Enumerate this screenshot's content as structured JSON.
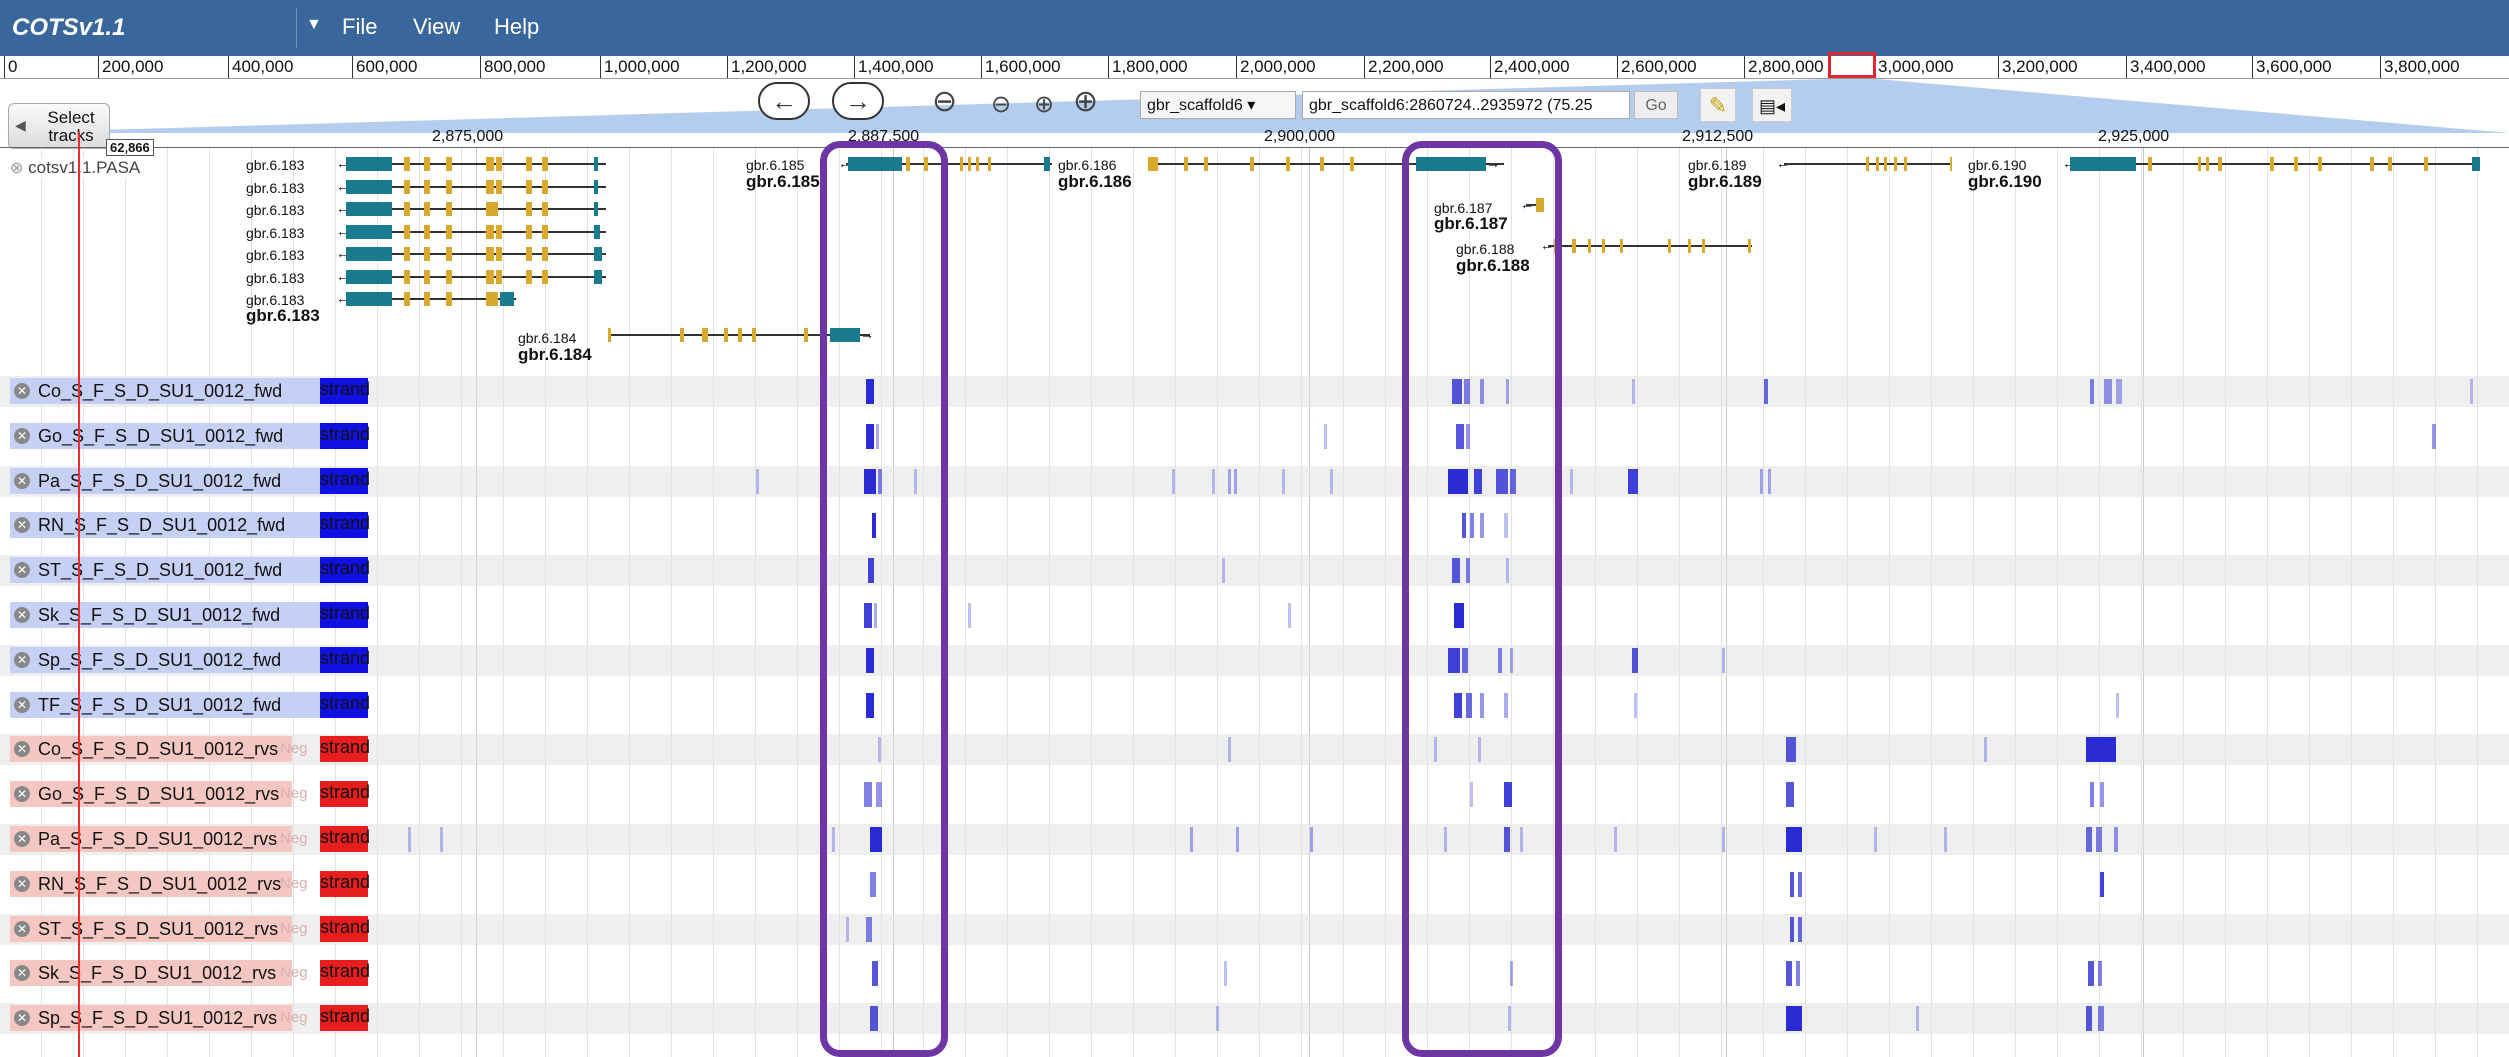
{
  "app": {
    "title": "COTSv1.1",
    "menu": [
      "File",
      "View",
      "Help"
    ]
  },
  "overview_ruler": {
    "ticks": [
      "0",
      "200,000",
      "400,000",
      "600,000",
      "800,000",
      "1,000,000",
      "1,200,000",
      "1,400,000",
      "1,600,000",
      "1,800,000",
      "2,000,000",
      "2,200,000",
      "2,400,000",
      "2,600,000",
      "2,800,000",
      "3,000,000",
      "3,200,000",
      "3,400,000",
      "3,600,000",
      "3,800,000"
    ]
  },
  "navigation": {
    "select_tracks": "Select tracks",
    "back_arrow": "←",
    "forward_arrow": "→",
    "refseq": "gbr_scaffold6",
    "location": "gbr_scaffold6:2860724..2935972 (75.25",
    "go": "Go"
  },
  "detail_ruler": {
    "ticks": [
      "2,875,000",
      "2,887,500",
      "2,900,000",
      "2,912,500",
      "2,925,000"
    ],
    "position_flag": "62,866"
  },
  "tracks": {
    "pasa": {
      "label": "cotsv1.1.PASA"
    },
    "genes": [
      {
        "id": "gbr.6.183",
        "transcript_labels": [
          "gbr.6.183",
          "gbr.6.183",
          "gbr.6.183",
          "gbr.6.183",
          "gbr.6.183",
          "gbr.6.183",
          "gbr.6.183"
        ],
        "name": "gbr.6.183"
      },
      {
        "id": "gbr.6.184",
        "label": "gbr.6.184",
        "name": "gbr.6.184"
      },
      {
        "id": "gbr.6.185",
        "label": "gbr.6.185",
        "name": "gbr.6.185"
      },
      {
        "id": "gbr.6.186",
        "label": "gbr.6.186",
        "name": "gbr.6.186"
      },
      {
        "id": "gbr.6.187",
        "label": "gbr.6.187",
        "name": "gbr.6.187"
      },
      {
        "id": "gbr.6.188",
        "label": "gbr.6.188",
        "name": "gbr.6.188"
      },
      {
        "id": "gbr.6.189",
        "label": "gbr.6.189",
        "name": "gbr.6.189"
      },
      {
        "id": "gbr.6.190",
        "label": "gbr.6.190",
        "name": "gbr.6.190"
      }
    ],
    "coverage": [
      {
        "label": "Co_S_F_S_D_SU1_0012_fwd",
        "strand": "strand",
        "dir": "fwd"
      },
      {
        "label": "Go_S_F_S_D_SU1_0012_fwd",
        "strand": "strand",
        "dir": "fwd"
      },
      {
        "label": "Pa_S_F_S_D_SU1_0012_fwd",
        "strand": "strand",
        "dir": "fwd"
      },
      {
        "label": "RN_S_F_S_D_SU1_0012_fwd",
        "strand": "strand",
        "dir": "fwd"
      },
      {
        "label": "ST_S_F_S_D_SU1_0012_fwd",
        "strand": "strand",
        "dir": "fwd"
      },
      {
        "label": "Sk_S_F_S_D_SU1_0012_fwd",
        "strand": "strand",
        "dir": "fwd"
      },
      {
        "label": "Sp_S_F_S_D_SU1_0012_fwd",
        "strand": "strand",
        "dir": "fwd"
      },
      {
        "label": "TF_S_F_S_D_SU1_0012_fwd",
        "strand": "strand",
        "dir": "fwd"
      },
      {
        "label": "Co_S_F_S_D_SU1_0012_rvs",
        "strand": "strand",
        "neg": "Neg",
        "dir": "rvs"
      },
      {
        "label": "Go_S_F_S_D_SU1_0012_rvs",
        "strand": "strand",
        "neg": "Neg",
        "dir": "rvs"
      },
      {
        "label": "Pa_S_F_S_D_SU1_0012_rvs",
        "strand": "strand",
        "neg": "Neg",
        "dir": "rvs"
      },
      {
        "label": "RN_S_F_S_D_SU1_0012_rvs",
        "strand": "strand",
        "neg": "Neg",
        "dir": "rvs"
      },
      {
        "label": "ST_S_F_S_D_SU1_0012_rvs",
        "strand": "strand",
        "neg": "Neg",
        "dir": "rvs"
      },
      {
        "label": "Sk_S_F_S_D_SU1_0012_rvs",
        "strand": "strand",
        "neg": "Neg",
        "dir": "rvs"
      },
      {
        "label": "Sp_S_F_S_D_SU1_0012_rvs",
        "strand": "strand",
        "neg": "Neg",
        "dir": "rvs"
      }
    ]
  },
  "colors": {
    "menubar": "#3a679b",
    "coverage_fwd": "#2b2bd6",
    "coverage_rvs": "#2b2bd6",
    "exon_utr": "#1b7b8e",
    "exon_cds": "#d9a92e",
    "callout": "#6e35a5",
    "current_position": "#ef2b2b"
  }
}
